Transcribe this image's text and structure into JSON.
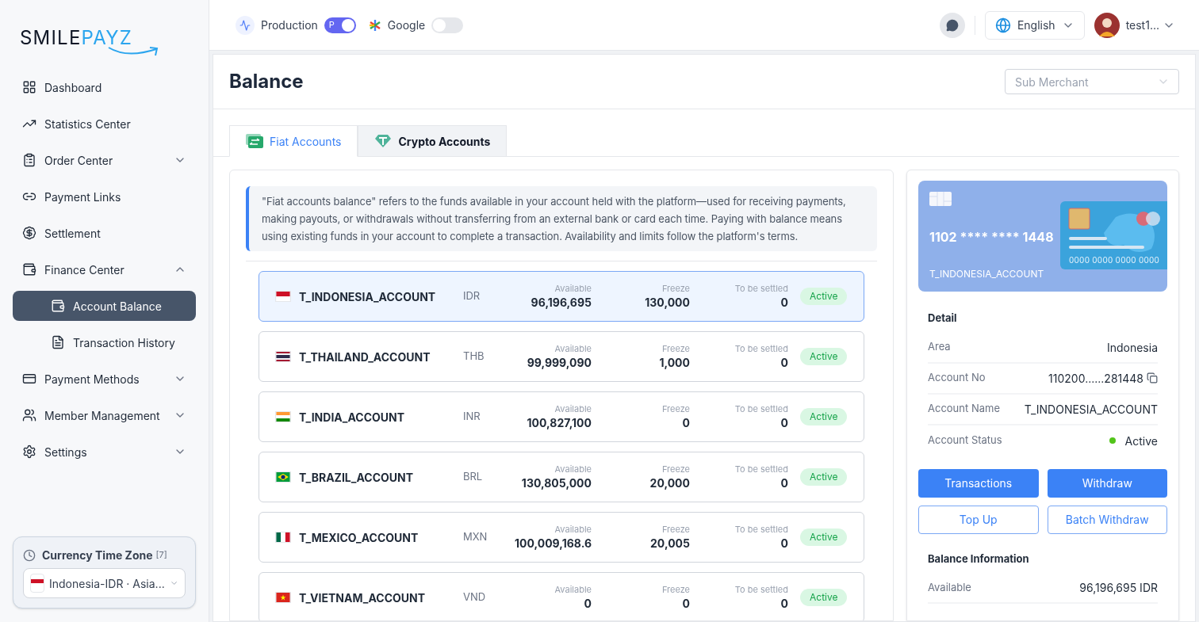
{
  "logo": {
    "part_1": "SMILE",
    "part_2": "PAYZ"
  },
  "sidebar": {
    "items": [
      {
        "label": "Dashboard",
        "selected": false
      },
      {
        "label": "Statistics Center",
        "selected": false
      },
      {
        "label": "Order Center",
        "selected": false,
        "expanded": false
      },
      {
        "label": "Payment Links",
        "selected": false
      },
      {
        "label": "Settlement",
        "selected": false
      },
      {
        "label": "Finance Center",
        "selected": false,
        "expanded": true,
        "children": [
          {
            "label": "Account Balance",
            "selected": true
          },
          {
            "label": "Transaction History",
            "selected": false
          }
        ]
      },
      {
        "label": "Payment Methods",
        "selected": false,
        "expanded": false
      },
      {
        "label": "Member Management",
        "selected": false,
        "expanded": false
      },
      {
        "label": "Settings",
        "selected": false,
        "expanded": false
      }
    ],
    "timezone": {
      "title": "Currency Time Zone",
      "count": "[7]",
      "value": "Indonesia-IDR · Asia..."
    }
  },
  "header": {
    "toggles": [
      {
        "label": "Production",
        "on": true,
        "knob": "P"
      },
      {
        "label": "Google",
        "on": false
      }
    ],
    "language": "English",
    "user": "test1..."
  },
  "page": {
    "title": "Balance",
    "sub_merchant": {
      "placeholder": "Sub Merchant"
    }
  },
  "tabs": [
    {
      "label": "Fiat Accounts",
      "selected": true
    },
    {
      "label": "Crypto Accounts",
      "selected": false
    }
  ],
  "notice": "\"Fiat accounts balance\" refers to the funds available in your account held with the platform—used for receiving payments, making payouts, or withdrawals without transferring from an external bank or card each time. Paying with balance means using existing funds in your account to complete a transaction. Availability and limits follow the platform's terms.",
  "accounts": [
    {
      "name": "T_INDONESIA_ACCOUNT",
      "currency": "IDR",
      "available_label": "Available",
      "available": "96,196,695",
      "freeze_label": "Freeze",
      "freeze": "130,000",
      "settle_label": "To be settled",
      "settle": "0",
      "status": "Active",
      "selected": true
    },
    {
      "name": "T_THAILAND_ACCOUNT",
      "currency": "THB",
      "available_label": "Available",
      "available": "99,999,090",
      "freeze_label": "Freeze",
      "freeze": "1,000",
      "settle_label": "To be settled",
      "settle": "0",
      "status": "Active",
      "selected": false
    },
    {
      "name": "T_INDIA_ACCOUNT",
      "currency": "INR",
      "available_label": "Available",
      "available": "100,827,100",
      "freeze_label": "Freeze",
      "freeze": "0",
      "settle_label": "To be settled",
      "settle": "0",
      "status": "Active",
      "selected": false
    },
    {
      "name": "T_BRAZIL_ACCOUNT",
      "currency": "BRL",
      "available_label": "Available",
      "available": "130,805,000",
      "freeze_label": "Freeze",
      "freeze": "20,000",
      "settle_label": "To be settled",
      "settle": "0",
      "status": "Active",
      "selected": false
    },
    {
      "name": "T_MEXICO_ACCOUNT",
      "currency": "MXN",
      "available_label": "Available",
      "available": "100,009,168.6",
      "freeze_label": "Freeze",
      "freeze": "20,005",
      "settle_label": "To be settled",
      "settle": "0",
      "status": "Active",
      "selected": false
    },
    {
      "name": "T_VIETNAM_ACCOUNT",
      "currency": "VND",
      "available_label": "Available",
      "available": "0",
      "freeze_label": "Freeze",
      "freeze": "0",
      "settle_label": "To be settled",
      "settle": "0",
      "status": "Active",
      "selected": false
    }
  ],
  "card": {
    "number": "1102 **** **** 1448",
    "name": "T_INDONESIA_ACCOUNT",
    "sample_number": "0000 0000 0000 0000"
  },
  "detail": {
    "title": "Detail",
    "rows": [
      {
        "label": "Area",
        "value": "Indonesia",
        "kind": "text"
      },
      {
        "label": "Account No",
        "value": "110200......281448",
        "kind": "copy"
      },
      {
        "label": "Account Name",
        "value": "T_INDONESIA_ACCOUNT",
        "kind": "text"
      },
      {
        "label": "Account Status",
        "value": "Active",
        "kind": "status",
        "color": "#52c41a"
      }
    ]
  },
  "actions": [
    {
      "label": "Transactions",
      "kind": "primary"
    },
    {
      "label": "Withdraw",
      "kind": "primary"
    },
    {
      "label": "Top Up",
      "kind": "outline"
    },
    {
      "label": "Batch Withdraw",
      "kind": "outline"
    }
  ],
  "balance": {
    "title": "Balance Information",
    "rows": [
      {
        "label": "Available",
        "value": "96,196,695 IDR"
      }
    ]
  }
}
